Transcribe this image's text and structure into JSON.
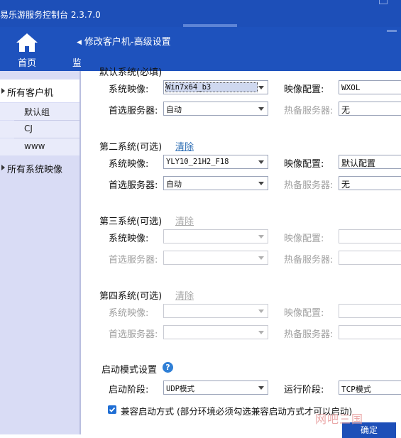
{
  "window": {
    "title": "易乐游服务控制台 2.3.7.0"
  },
  "nav": {
    "home_label": "首页",
    "monitor_partial": "监",
    "breadcrumb": "修改客户机-高级设置"
  },
  "sidebar": {
    "all_clients": "所有客户机",
    "groups": [
      "默认组",
      "CJ",
      "www"
    ],
    "all_images": "所有系统映像"
  },
  "form": {
    "default_system": {
      "title": "默认系统(必填)",
      "image_label": "系统映像:",
      "image_value": "Win7x64_b3",
      "config_label": "映像配置:",
      "config_value": "WXOL",
      "server_label": "首选服务器:",
      "server_value": "自动",
      "hot_label": "热备服务器:",
      "hot_value": "无"
    },
    "second_system": {
      "title": "第二系统(可选)",
      "clear": "清除",
      "image_label": "系统映像:",
      "image_value": "YLY10_21H2_F18",
      "config_label": "映像配置:",
      "config_value": "默认配置",
      "server_label": "首选服务器:",
      "server_value": "自动",
      "hot_label": "热备服务器:",
      "hot_value": "无"
    },
    "third_system": {
      "title": "第三系统(可选)",
      "clear": "清除",
      "image_label": "系统映像:",
      "config_label": "映像配置:",
      "server_label": "首选服务器:",
      "hot_label": "热备服务器:"
    },
    "fourth_system": {
      "title": "第四系统(可选)",
      "clear": "清除",
      "image_label": "系统映像:",
      "config_label": "映像配置:",
      "server_label": "首选服务器:",
      "hot_label": "热备服务器:"
    },
    "boot_mode": {
      "title": "启动模式设置",
      "help": "?",
      "boot_stage_label": "启动阶段:",
      "boot_stage_value": "UDP模式",
      "run_stage_label": "运行阶段:",
      "run_stage_value": "TCP模式",
      "compat_checked": true,
      "compat_label": "兼容启动方式 (部分环境必须勾选兼容启动方式才可以启动)"
    },
    "confirm": "确定"
  },
  "watermark": "网吧三国",
  "colors": {
    "titlebar": "#1d4fb8",
    "navbar": "#1e52bd",
    "sidebar": "#d9dcf5",
    "link": "#2f6fb5"
  }
}
